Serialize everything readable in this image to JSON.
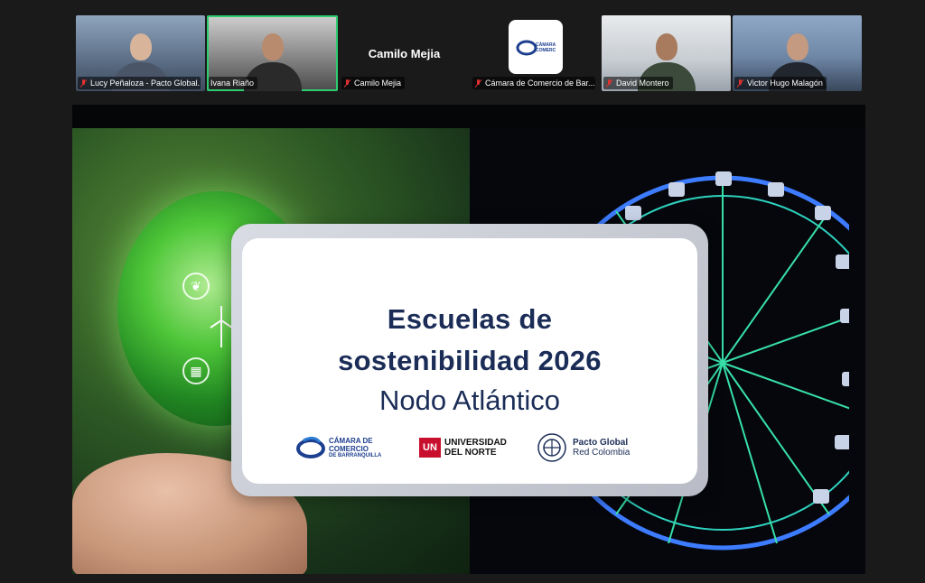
{
  "participants": [
    {
      "name": "Lucy Peñaloza - Pacto Global...",
      "muted": true
    },
    {
      "name": "Ivana Riaño",
      "muted": false,
      "active": true
    },
    {
      "name": "Camilo Mejia",
      "muted": true,
      "display_name": "Camilo Mejia"
    },
    {
      "name": "Cámara de Comercio de Bar...",
      "muted": true
    },
    {
      "name": "David Montero",
      "muted": true
    },
    {
      "name": "Victor Hugo Malagón",
      "muted": true
    }
  ],
  "slide": {
    "title_line1": "Escuelas de",
    "title_line2": "sostenibilidad 2026",
    "subtitle": "Nodo Atlántico",
    "logos": {
      "camara_line1": "CÁMARA DE",
      "camara_line2": "COMERCIO",
      "camara_line3": "DE BARRANQUILLA",
      "un_mark": "UN",
      "un_line1": "UNIVERSIDAD",
      "un_line2": "DEL NORTE",
      "pacto_line1": "Pacto Global",
      "pacto_line2": "Red Colombia"
    }
  },
  "colors": {
    "active_border": "#2ecc71",
    "mic_off": "#e03131",
    "title_navy": "#1b2d57"
  }
}
